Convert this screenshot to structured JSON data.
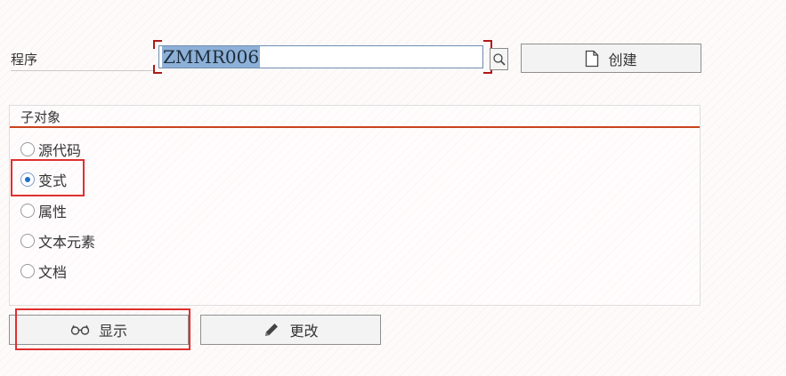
{
  "program": {
    "label": "程序",
    "value": "ZMMR006",
    "create_label": "创建",
    "search_icon": "search-icon",
    "create_icon": "document-icon"
  },
  "subobjects": {
    "title": "子对象",
    "options": [
      {
        "label": "源代码",
        "selected": false
      },
      {
        "label": "变式",
        "selected": true
      },
      {
        "label": "属性",
        "selected": false
      },
      {
        "label": "文本元素",
        "selected": false
      },
      {
        "label": "文档",
        "selected": false
      }
    ]
  },
  "actions": {
    "display_label": "显示",
    "display_icon": "glasses-icon",
    "change_label": "更改",
    "change_icon": "pencil-icon"
  },
  "colors": {
    "accent_line": "#c8431c",
    "highlight": "#e03030",
    "input_selection": "#8db0d8",
    "radio_dot": "#1d6fcc"
  }
}
